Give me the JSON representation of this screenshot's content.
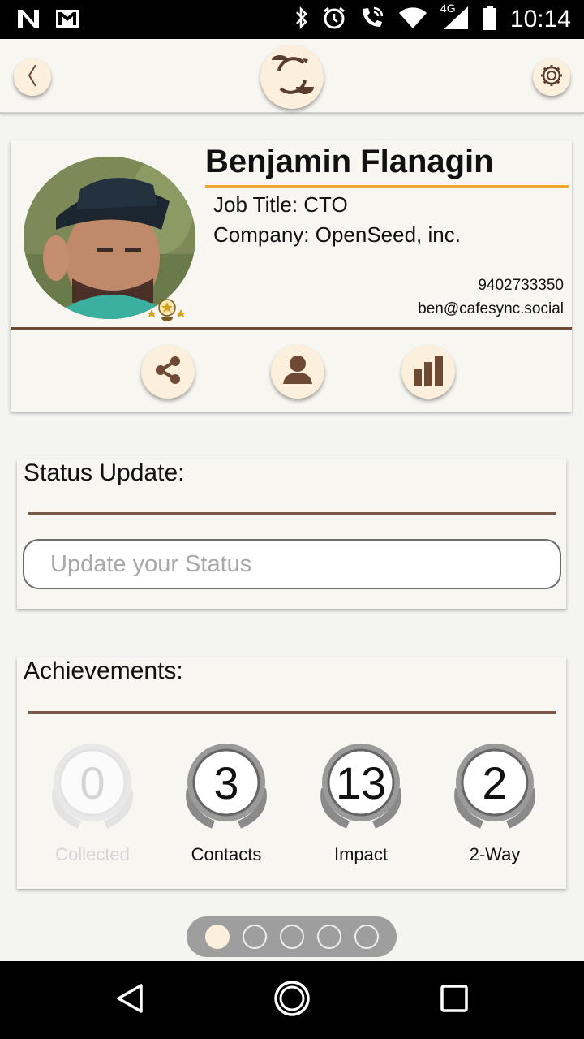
{
  "status_bar": {
    "time": "10:14",
    "network": "4G",
    "icons": [
      "n-icon",
      "gmail-icon",
      "bluetooth-icon",
      "alarm-icon",
      "wifi-call-icon",
      "wifi-icon",
      "signal-icon",
      "battery-icon"
    ]
  },
  "app_bar": {
    "back_icon": "chevron-left-icon",
    "logo_icon": "cafesync-logo-icon",
    "settings_icon": "gear-icon"
  },
  "profile": {
    "name": "Benjamin Flanagin",
    "job_title": "Job Title: CTO",
    "company": "Company: OpenSeed, inc.",
    "phone": "9402733350",
    "email": "ben@cafesync.social",
    "actions": [
      {
        "icon": "share-icon"
      },
      {
        "icon": "person-icon"
      },
      {
        "icon": "bar-chart-icon"
      }
    ]
  },
  "status_update": {
    "title": "Status Update:",
    "input_value": "",
    "placeholder": "Update your Status"
  },
  "achievements": {
    "title": "Achievements:",
    "items": [
      {
        "value": "0",
        "label": "Collected"
      },
      {
        "value": "3",
        "label": "Contacts"
      },
      {
        "value": "13",
        "label": "Impact"
      },
      {
        "value": "2",
        "label": "2-Way"
      }
    ]
  },
  "pager": {
    "page_count": 5,
    "current_page": 1
  },
  "colors": {
    "accent": "#f2a92f",
    "brown": "#6e4a34",
    "button_bg": "#fcefdc",
    "background": "#f4f4f1"
  },
  "nav_bar": {
    "icons": [
      "back-triangle-icon",
      "home-circle-icon",
      "recents-square-icon"
    ]
  }
}
